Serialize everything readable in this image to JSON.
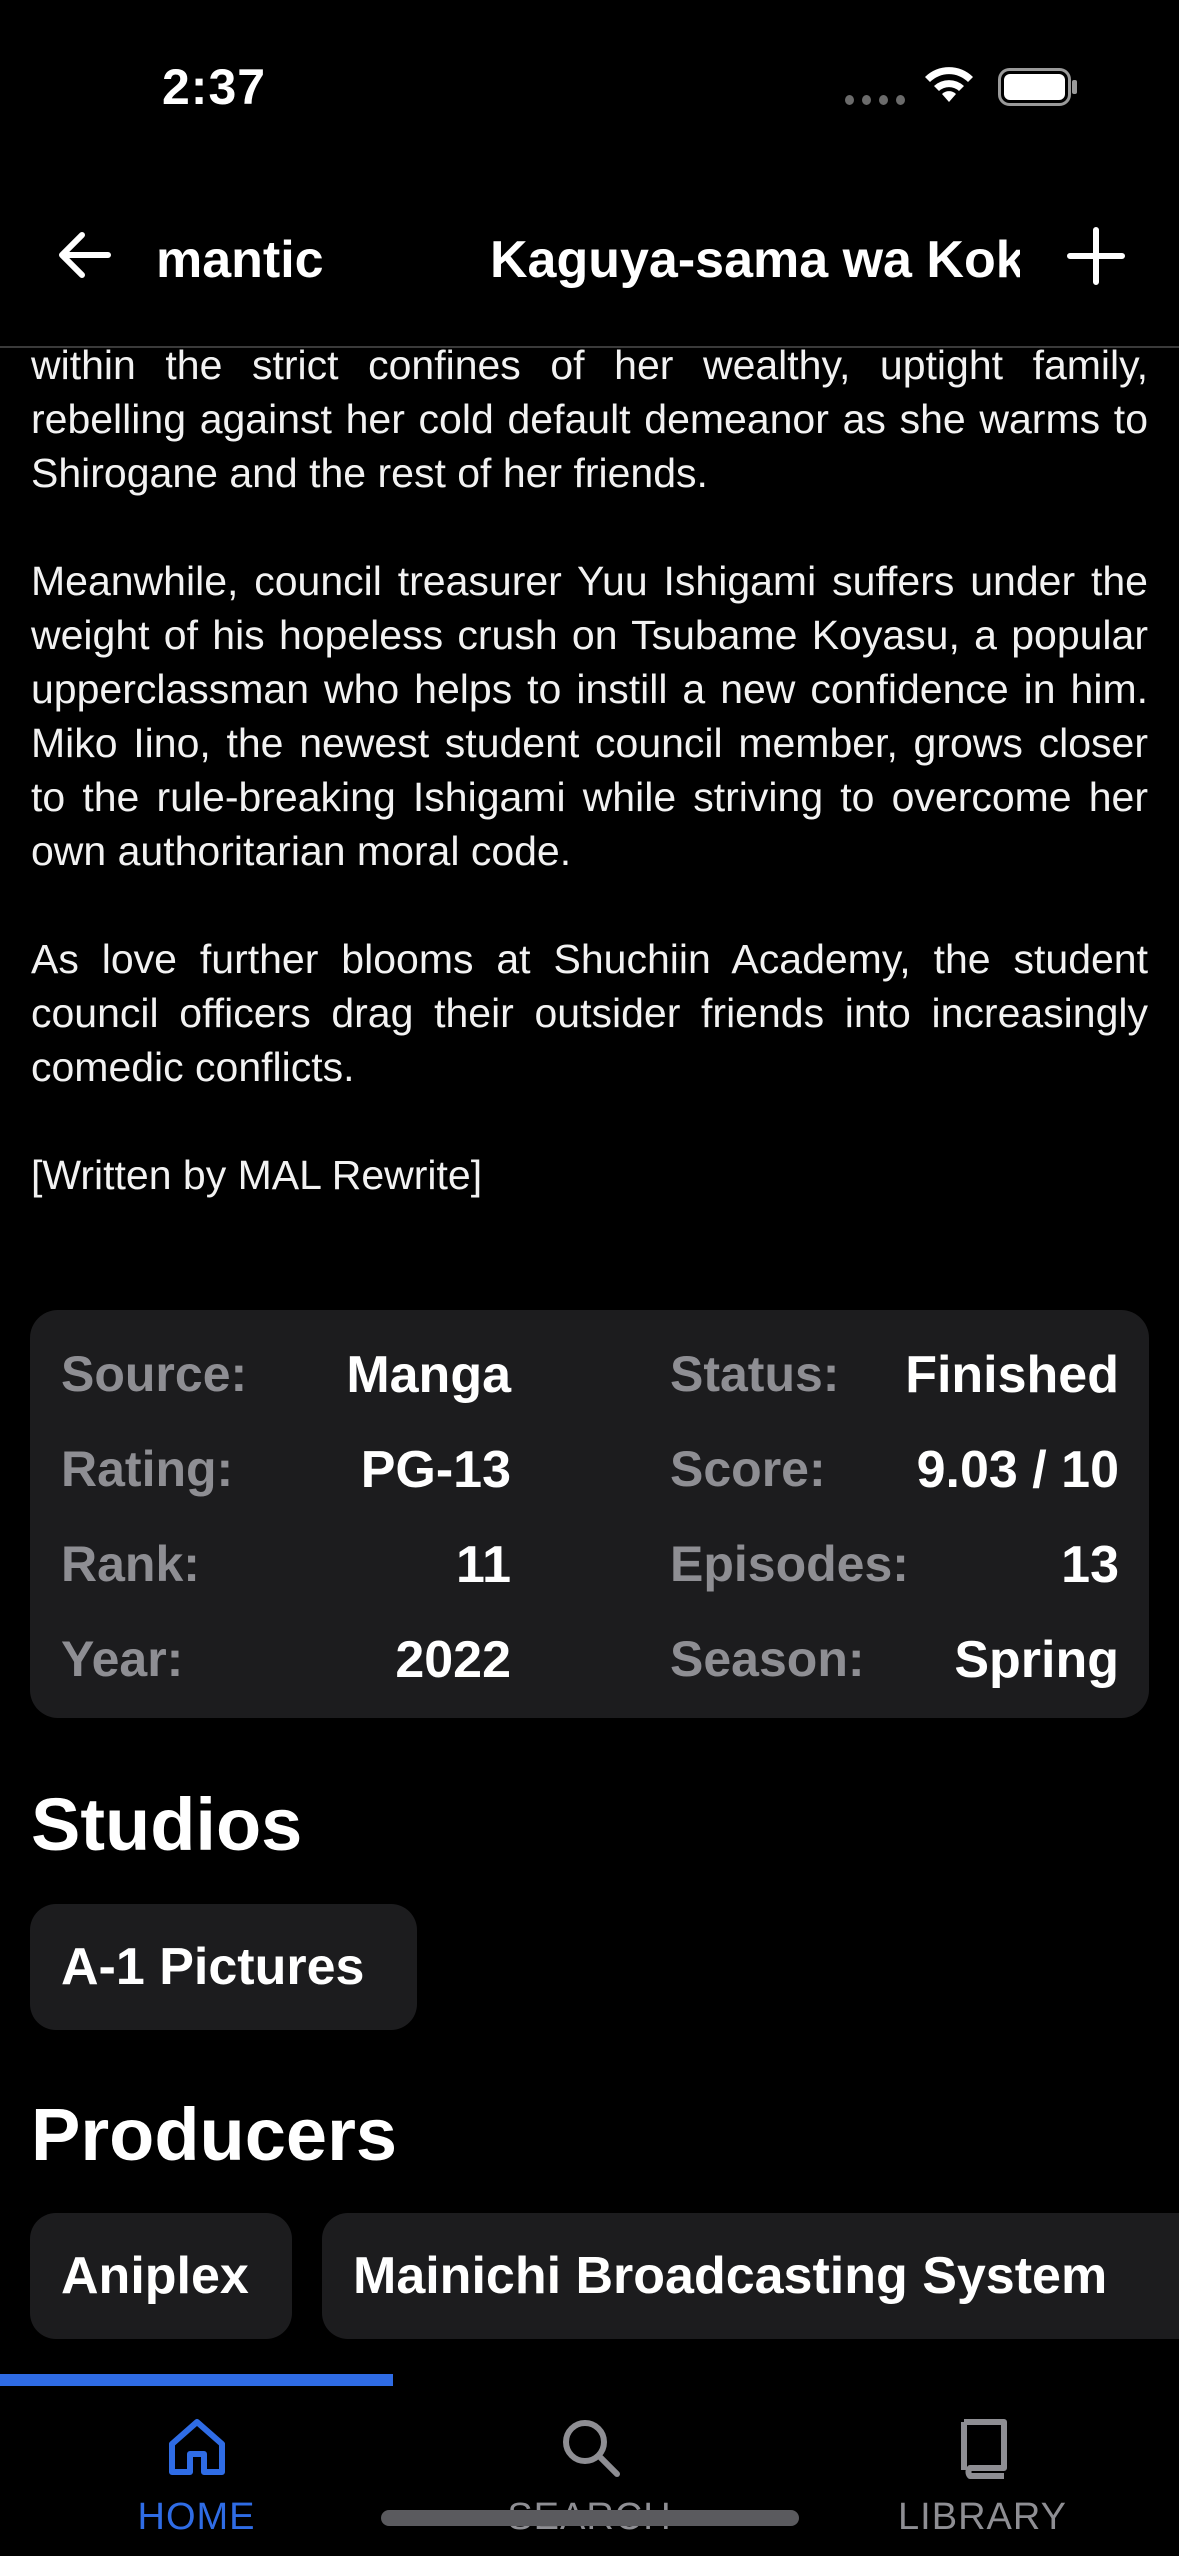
{
  "status_bar": {
    "time": "2:37"
  },
  "nav": {
    "title_left": "mantic",
    "title_right": "Kaguya-sama wa Kokurasetai: Ultra Romantic",
    "back_icon": "arrow-left-icon",
    "add_icon": "plus-icon"
  },
  "synopsis": {
    "p1": "within the strict confines of her wealthy, uptight family, rebelling against her cold default demeanor as she warms to Shirogane and the rest of her friends.",
    "p2": "Meanwhile, council treasurer Yuu Ishigami suffers under the weight of his hopeless crush on Tsubame Koyasu, a popular upperclassman who helps to instill a new confidence in him. Miko Iino, the newest student council member, grows closer to the rule-breaking Ishigami while striving to overcome her own authoritarian moral code.",
    "p3": "As love further blooms at Shuchiin Academy, the student council officers drag their outsider friends into increasingly comedic conflicts.",
    "p4": "[Written by MAL Rewrite]"
  },
  "info": {
    "source_label": "Source:",
    "source": "Manga",
    "status_label": "Status:",
    "status": "Finished",
    "rating_label": "Rating:",
    "rating": "PG-13",
    "score_label": "Score:",
    "score": "9.03 / 10",
    "rank_label": "Rank:",
    "rank": "11",
    "episodes_label": "Episodes:",
    "episodes": "13",
    "year_label": "Year:",
    "year": "2022",
    "season_label": "Season:",
    "season": "Spring"
  },
  "studios": {
    "title": "Studios",
    "items": [
      "A-1 Pictures"
    ]
  },
  "producers": {
    "title": "Producers",
    "items": [
      "Aniplex",
      "Mainichi Broadcasting System"
    ]
  },
  "tabs": [
    {
      "label": "HOME",
      "icon": "home-icon",
      "active": true,
      "color": "#2f6ce5"
    },
    {
      "label": "SEARCH",
      "icon": "search-icon",
      "active": false,
      "color": "#8e8e93"
    },
    {
      "label": "LIBRARY",
      "icon": "book-icon",
      "active": false,
      "color": "#8e8e93"
    }
  ]
}
